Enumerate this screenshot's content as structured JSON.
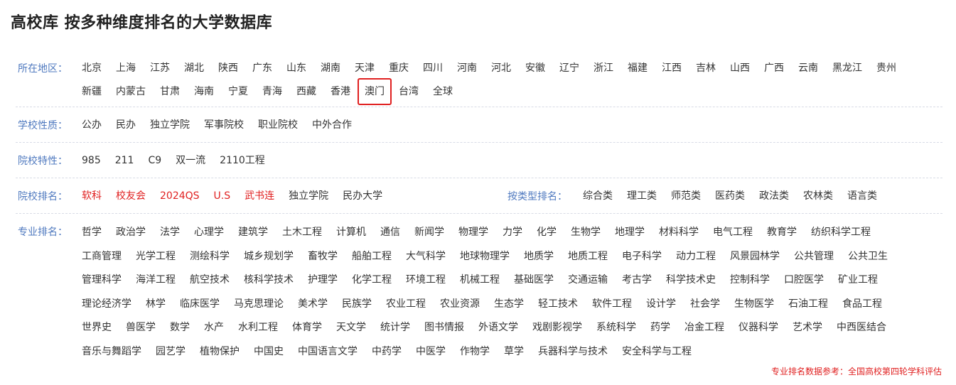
{
  "page": {
    "title": "高校库 按多种维度排名的大学数据库"
  },
  "filters": {
    "region": {
      "label": "所在地区：",
      "lines": [
        [
          "北京",
          "上海",
          "江苏",
          "湖北",
          "陕西",
          "广东",
          "山东",
          "湖南",
          "天津",
          "重庆",
          "四川",
          "河南",
          "河北",
          "安徽",
          "辽宁",
          "浙江",
          "福建",
          "江西",
          "吉林",
          "山西",
          "广西",
          "云南",
          "黑龙江",
          "贵州"
        ],
        [
          "新疆",
          "内蒙古",
          "甘肃",
          "海南",
          "宁夏",
          "青海",
          "西藏",
          "香港",
          "澳门",
          "台湾",
          "全球"
        ]
      ],
      "selected": "澳门"
    },
    "nature": {
      "label": "学校性质：",
      "options": [
        "公办",
        "民办",
        "独立学院",
        "军事院校",
        "职业院校",
        "中外合作"
      ]
    },
    "feature": {
      "label": "院校特性：",
      "options": [
        "985",
        "211",
        "C9",
        "双一流",
        "2110工程"
      ]
    },
    "ranking": {
      "label": "院校排名：",
      "options": [
        {
          "text": "软科",
          "highlight": true
        },
        {
          "text": "校友会",
          "highlight": true
        },
        {
          "text": "2024QS",
          "highlight": true
        },
        {
          "text": "U.S",
          "highlight": true
        },
        {
          "text": "武书连",
          "highlight": true
        },
        {
          "text": "独立学院",
          "highlight": false
        },
        {
          "text": "民办大学",
          "highlight": false
        }
      ],
      "type_label": "按类型排名：",
      "type_options": [
        "综合类",
        "理工类",
        "师范类",
        "医药类",
        "政法类",
        "农林类",
        "语言类"
      ]
    },
    "major": {
      "label": "专业排名：",
      "lines": [
        [
          "哲学",
          "政治学",
          "法学",
          "心理学",
          "建筑学",
          "土木工程",
          "计算机",
          "通信",
          "新闻学",
          "物理学",
          "力学",
          "化学",
          "生物学",
          "地理学",
          "材料科学",
          "电气工程",
          "教育学",
          "纺织科学工程"
        ],
        [
          "工商管理",
          "光学工程",
          "测绘科学",
          "城乡规划学",
          "畜牧学",
          "船舶工程",
          "大气科学",
          "地球物理学",
          "地质学",
          "地质工程",
          "电子科学",
          "动力工程",
          "风景园林学",
          "公共管理",
          "公共卫生"
        ],
        [
          "管理科学",
          "海洋工程",
          "航空技术",
          "核科学技术",
          "护理学",
          "化学工程",
          "环境工程",
          "机械工程",
          "基础医学",
          "交通运输",
          "考古学",
          "科学技术史",
          "控制科学",
          "口腔医学",
          "矿业工程"
        ],
        [
          "理论经济学",
          "林学",
          "临床医学",
          "马克思理论",
          "美术学",
          "民族学",
          "农业工程",
          "农业资源",
          "生态学",
          "轻工技术",
          "软件工程",
          "设计学",
          "社会学",
          "生物医学",
          "石油工程",
          "食品工程"
        ],
        [
          "世界史",
          "兽医学",
          "数学",
          "水产",
          "水利工程",
          "体育学",
          "天文学",
          "统计学",
          "图书情报",
          "外语文学",
          "戏剧影视学",
          "系统科学",
          "药学",
          "冶金工程",
          "仪器科学",
          "艺术学",
          "中西医结合"
        ],
        [
          "音乐与舞蹈学",
          "园艺学",
          "植物保护",
          "中国史",
          "中国语言文学",
          "中药学",
          "中医学",
          "作物学",
          "草学",
          "兵器科学与技术",
          "安全科学与工程"
        ]
      ]
    }
  },
  "footnote": "专业排名数据参考：全国高校第四轮学科评估",
  "colors": {
    "label_blue": "#4f79bf",
    "highlight_red": "#e02020",
    "text": "#333333"
  }
}
